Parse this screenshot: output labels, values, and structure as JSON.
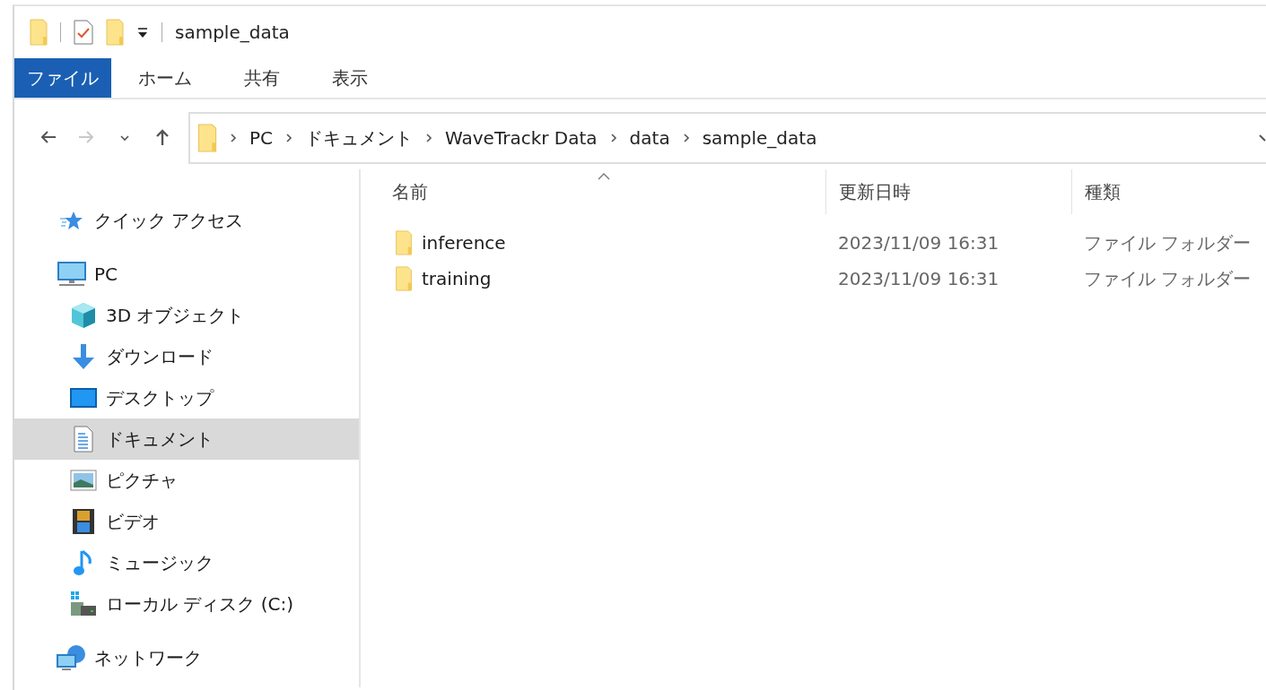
{
  "window": {
    "title": "sample_data"
  },
  "ribbon_tabs": [
    {
      "label": "ファイル",
      "selected": true
    },
    {
      "label": "ホーム",
      "selected": false
    },
    {
      "label": "共有",
      "selected": false
    },
    {
      "label": "表示",
      "selected": false
    }
  ],
  "nav_buttons": [
    {
      "disabled": false
    },
    {
      "disabled": true
    },
    {
      "disabled": false
    },
    {
      "disabled": false
    }
  ],
  "address_bar": {
    "path": [
      "PC",
      "ドキュメント",
      "WaveTrackr Data",
      "data",
      "sample_data"
    ]
  },
  "sidebar": {
    "items": [
      {
        "label": "クイック アクセス",
        "selected": false
      },
      {
        "label": "PC",
        "selected": false,
        "children": [
          {
            "label": "3D オブジェクト",
            "selected": false
          },
          {
            "label": "ダウンロード",
            "selected": false
          },
          {
            "label": "デスクトップ",
            "selected": false
          },
          {
            "label": "ドキュメント",
            "selected": true
          },
          {
            "label": "ピクチャ",
            "selected": false
          },
          {
            "label": "ビデオ",
            "selected": false
          },
          {
            "label": "ミュージック",
            "selected": false
          },
          {
            "label": "ローカル ディスク (C:)",
            "selected": false
          }
        ]
      },
      {
        "label": "ネットワーク",
        "selected": false
      }
    ]
  },
  "table": {
    "columns": [
      "名前",
      "更新日時",
      "種類"
    ],
    "rows": [
      {
        "name": "inference",
        "modified": "2023/11/09 16:31",
        "type": "ファイル フォルダー",
        "selected": false
      },
      {
        "name": "training",
        "modified": "2023/11/09 16:31",
        "type": "ファイル フォルダー",
        "selected": false
      }
    ]
  }
}
